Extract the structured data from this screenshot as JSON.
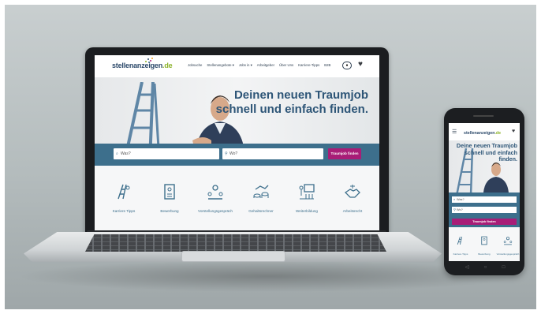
{
  "site": {
    "logo_text": "stellenanzeigen",
    "logo_suffix": ".de",
    "logo_dot_colors": [
      "#8cb32a",
      "#2d4a6b",
      "#a81d77",
      "#3d6f8c",
      "#f0a020"
    ]
  },
  "nav": {
    "items": [
      "Jobsuche",
      "Stellenangebote ▾",
      "Jobs in ▾",
      "Arbeitgeber",
      "Über Uns",
      "Karriere-Tipps",
      "B2B"
    ]
  },
  "hero": {
    "title_line1": "Deinen neuen Traumjob",
    "title_line2": "schnell und einfach finden."
  },
  "search": {
    "what_placeholder": "Was?",
    "where_placeholder": "Wo?",
    "button_label": "Traumjob finden"
  },
  "categories": [
    {
      "label": "Karriere Tipps",
      "icon": "ladder-climber-icon"
    },
    {
      "label": "Bewerbung",
      "icon": "application-document-icon"
    },
    {
      "label": "Vorstellungsgespräch",
      "icon": "interview-meeting-icon"
    },
    {
      "label": "Gehaltsrechner",
      "icon": "salary-coins-icon"
    },
    {
      "label": "Weiterbildung",
      "icon": "training-presentation-icon"
    },
    {
      "label": "Arbeitsrecht",
      "icon": "handshake-law-icon"
    }
  ],
  "mobile": {
    "title_line1": "Deine neuen Traumjob",
    "title_line2": "schnell und einfach finden.",
    "categories": [
      "Karriere Tipps",
      "Bewerbung",
      "Vorstellungsgespräch"
    ]
  },
  "colors": {
    "brand_blue": "#3d6f8c",
    "title_blue": "#2d5577",
    "accent_magenta": "#a81d77",
    "logo_green": "#8cb32a"
  }
}
